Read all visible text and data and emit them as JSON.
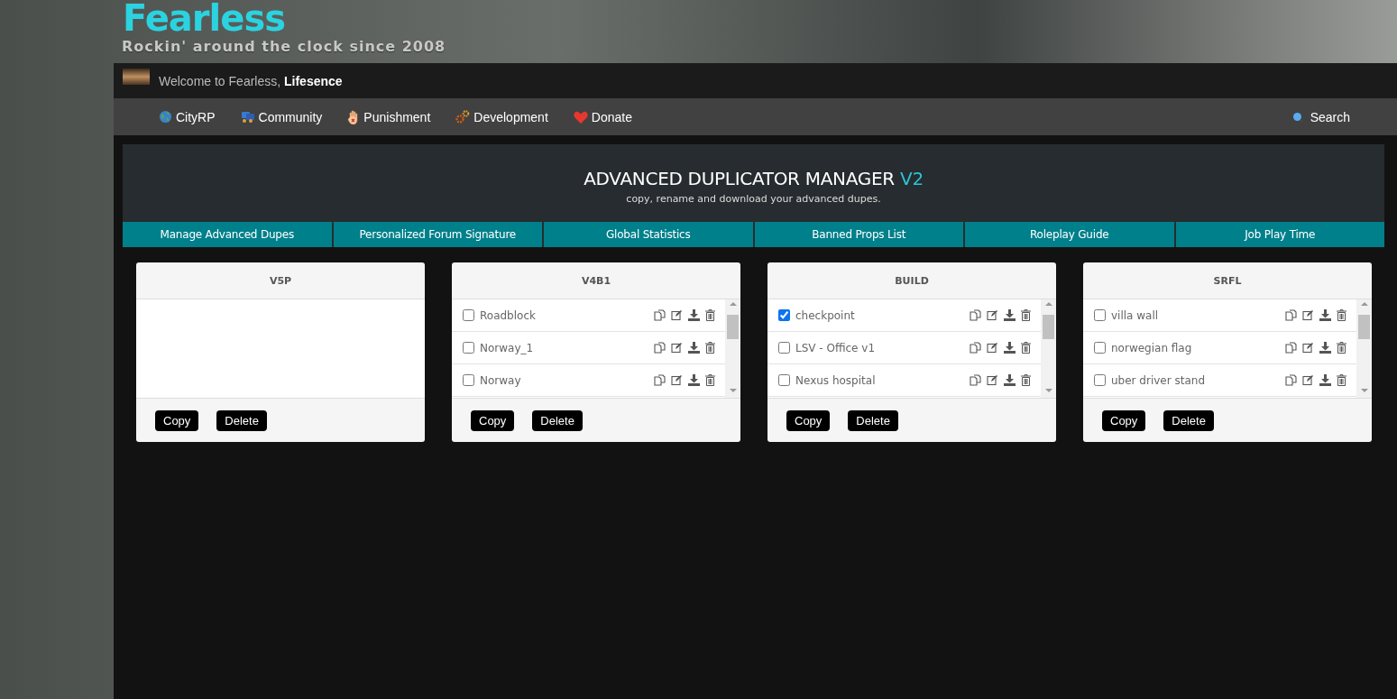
{
  "header": {
    "logo": "Fearless",
    "tagline": "Rockin' around the clock since 2008"
  },
  "welcome": {
    "text": "Welcome to Fearless, ",
    "user": "Lifesence"
  },
  "nav": {
    "items": [
      {
        "label": "CityRP"
      },
      {
        "label": "Community"
      },
      {
        "label": "Punishment"
      },
      {
        "label": "Development"
      },
      {
        "label": "Donate"
      }
    ],
    "search": "Search"
  },
  "manager": {
    "title": "ADVANCED DUPLICATOR MANAGER ",
    "version": "V2",
    "subtitle": "copy, rename and download your advanced dupes."
  },
  "tabs": [
    "Manage Advanced Dupes",
    "Personalized Forum Signature",
    "Global Statistics",
    "Banned Props List",
    "Roleplay Guide",
    "Job Play Time"
  ],
  "panels": [
    {
      "title": "V5P",
      "buttons": [
        "Copy",
        "Delete"
      ]
    },
    {
      "title": "V4B1",
      "items": [
        {
          "name": "Roadblock",
          "checked": false
        },
        {
          "name": "Norway_1",
          "checked": false
        },
        {
          "name": "Norway",
          "checked": false
        }
      ],
      "buttons": [
        "Copy",
        "Delete"
      ]
    },
    {
      "title": "BUILD",
      "items": [
        {
          "name": "checkpoint",
          "checked": true
        },
        {
          "name": "LSV - Office v1",
          "checked": false
        },
        {
          "name": "Nexus hospital",
          "checked": false
        }
      ],
      "buttons": [
        "Copy",
        "Delete"
      ]
    },
    {
      "title": "SRFL",
      "items": [
        {
          "name": "villa wall",
          "checked": false
        },
        {
          "name": "norwegian flag",
          "checked": false
        },
        {
          "name": "uber driver stand",
          "checked": false
        }
      ],
      "buttons": [
        "Copy",
        "Delete"
      ]
    }
  ]
}
